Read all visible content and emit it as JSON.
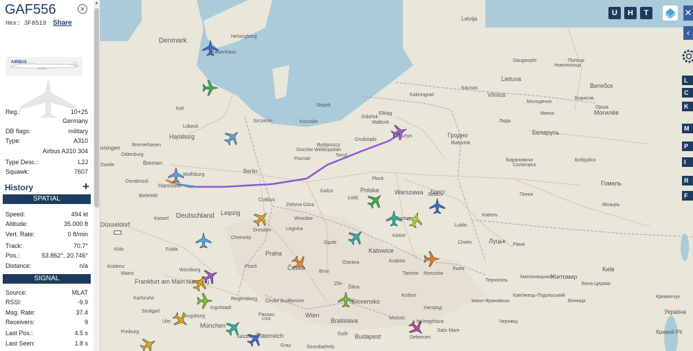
{
  "info": {
    "callsign": "GAF556",
    "hex_label": "Hex:",
    "hex": "3F8519",
    "share": "Share",
    "airline_logo": "AIRBUS",
    "fields": [
      {
        "k": "Reg.:",
        "v": "10+25"
      },
      {
        "k": "",
        "v": "Germany"
      },
      {
        "k": "DB flags:",
        "v": "military"
      },
      {
        "k": "Type:",
        "v": "A310"
      },
      {
        "k": "",
        "v": "Airbus A310 304"
      },
      {
        "k": "Type Desc.:",
        "v": "L2J"
      },
      {
        "k": "Squawk:",
        "v": "7607"
      }
    ],
    "history_label": "History",
    "spatial_label": "SPATIAL",
    "spatial": [
      {
        "k": "Speed:",
        "v": "494 kt"
      },
      {
        "k": "Altitude:",
        "v": "35.000 ft"
      },
      {
        "k": "Vert. Rate:",
        "v": "0 ft/min"
      },
      {
        "k": "Track:",
        "v": "70.7°"
      },
      {
        "k": "Pos.:",
        "v": "53.862°, 20.746°"
      },
      {
        "k": "Distance:",
        "v": "n/a"
      }
    ],
    "signal_label": "SIGNAL",
    "signal": [
      {
        "k": "Source:",
        "v": "MLAT"
      },
      {
        "k": "RSSI:",
        "v": "-9.9"
      },
      {
        "k": "Msg. Rate:",
        "v": "37.4"
      },
      {
        "k": "Receivers:",
        "v": "9"
      },
      {
        "k": "Last Pos.:",
        "v": "4.5 s"
      },
      {
        "k": "Last Seen:",
        "v": "1.8 s"
      }
    ]
  },
  "toolbar": {
    "u": "U",
    "h": "H",
    "t": "T",
    "side": [
      "L",
      "C",
      "K",
      "M",
      "P",
      "I",
      "R",
      "F"
    ]
  },
  "map_labels": {
    "denmark": "Denmark",
    "kobenhavn": "København",
    "helsingborg": "Helsingborg",
    "hamburg": "Hamburg",
    "bremen": "Bremen",
    "hannover": "Hannover",
    "berlin": "Berlin",
    "deutschland": "Deutschland",
    "leipzig": "Leipzig",
    "dresden": "Dresden",
    "frankfurt": "Frankfurt am Main",
    "nurnberg": "Nürnberg",
    "munchen": "München",
    "praha": "Praha",
    "cesko": "Česko",
    "brno": "Brno",
    "wien": "Wien",
    "osterreich": "Österreich",
    "bratislava": "Bratislava",
    "budapest": "Budapest",
    "slovensko": "Slovensko",
    "polska": "Polska",
    "warszawa": "Warszawa",
    "gdansk": "Gdańsk",
    "szczecin": "Szczecin",
    "poznan": "Poznań",
    "wroclaw": "Wrocław",
    "katowice": "Katowice",
    "krakow": "Kraków",
    "lodz": "Łódź",
    "lublin": "Lublin",
    "bialystok": "Białystok",
    "kaliningrad": "Kaliningrad",
    "latvija": "Latvija",
    "lietuva": "Lietuva",
    "kaunas": "Kaunas",
    "vilnius": "Vilnius",
    "daugavpils": "Daugavpils",
    "grodno": "Гродно",
    "belarus": "Беларусь",
    "minsk": "Минск",
    "brest": "Брест",
    "pinsk": "Пинск",
    "gomel": "Гомель",
    "mogilev": "Могилёв",
    "vitebsk": "Витебск",
    "orsha": "Орша",
    "lutsk": "Луцьк",
    "rivne": "Рівне",
    "zhytomyr": "Житомир",
    "kyiv": "Київ",
    "ukraina": "Україна",
    "lviv": "Львів",
    "kremenchuk": "Кременчук",
    "kryvyi": "Кривий Ріг",
    "duseldorf": "Düsseldorf",
    "osnabruck": "Osnabrück",
    "bielefeld": "Bielefeld",
    "oldenburg": "Oldenburg",
    "wolfsburg": "Wolfsburg",
    "koln": "Köln",
    "kassel": "Kassel",
    "chemnitz": "Chemnitz",
    "augsburg": "Augsburg",
    "karlsruhe": "Karlsruhe",
    "regensburg": "Regensburg",
    "linz": "Linz",
    "salzburg": "Salzburg",
    "graz": "Graz",
    "gyor": "Győr",
    "debrecen": "Debrecen",
    "kosice": "Košice",
    "ostrava": "Ostrava",
    "zilina": "Žilina",
    "olsztyn": "Olsztyn",
    "bydgoszcz": "Bydgoszcz",
    "torun": "Toruń",
    "cottbus": "Cottbus",
    "zielona": "Zielona Góra",
    "gorzow": "Gorzów Wielkopolski",
    "koszalin": "Koszalin",
    "slupsk": "Słupsk",
    "elblag": "Elbląg",
    "grudziadz": "Grudziądz",
    "plock": "Płock",
    "radom": "Radom",
    "kielce": "Kielce",
    "rzeszow": "Rzeszów",
    "siedlce": "Siedlce",
    "lubeck": "Lübeck",
    "kiel": "Kiel",
    "bremerhaven": "Bremerhaven",
    "groningen": "oningen",
    "zwolle": "Zwolle",
    "plzen": "Plzeň",
    "ceske": "České Budějovice",
    "tarnow": "Tarnów",
    "chelm": "Chełm",
    "kalisz": "Kalisz",
    "legnica": "Legnica",
    "opole": "Opole",
    "zlin": "Zlín",
    "kovel": "Ковель",
    "baranovichi": "Барановичи",
    "soligorsk": "Солигорск",
    "bobruisk": "Бобруйск",
    "mozyr": "Мозырь",
    "borisov": "Борисов",
    "molodechno": "Молодечно",
    "lida": "Лида",
    "polotsk": "Полоцк",
    "novopolotsk": "Новополоцк",
    "belaya": "Бела Церква",
    "kamenets": "Кам'янець-Подільський",
    "ivano": "Івано-Франківськ",
    "ternopil": "Тернопіль",
    "chernivtsi": "Чернівці",
    "khmelnytskyi": "Хмельницький",
    "vinnytsia": "Вінниця",
    "uzhhorod": "Ужгород",
    "nyiregyhaza": "Nyíregyháza",
    "miskolc": "Miskolc",
    "satu": "Satu Mare",
    "szombathely": "Szombathely",
    "malbork": "Malbork",
    "ingolstadt": "Ingolstadt",
    "fulda": "Fulda",
    "wurzburg": "Würzburg",
    "mainz": "Mainz",
    "koblenz": "Koblenz",
    "freiburg": "Freiburg",
    "ulm": "Ulm",
    "stuttgart": "Stuttgart",
    "passau": "Passau"
  }
}
